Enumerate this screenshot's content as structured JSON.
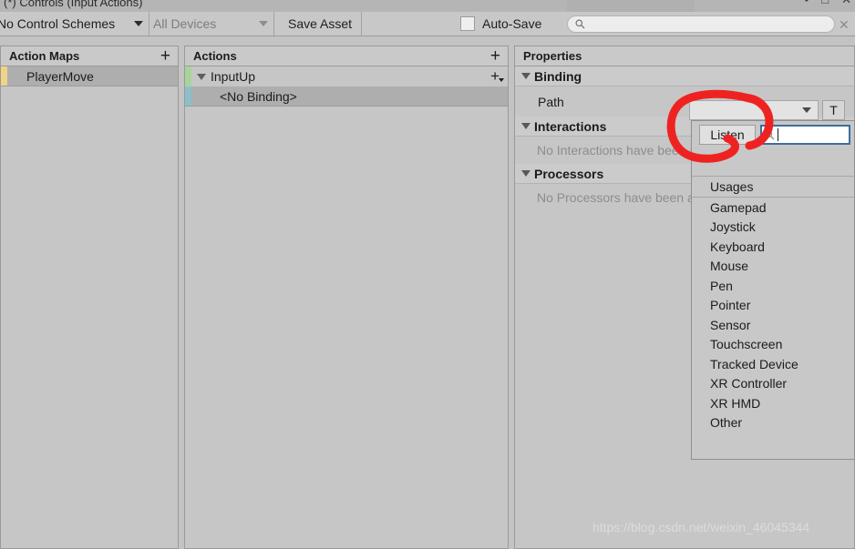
{
  "window": {
    "title": "(*) Controls (Input Actions)",
    "buttons": [
      {
        "name": "minimize-button",
        "glyph": "•"
      },
      {
        "name": "maximize-button",
        "glyph": "□"
      },
      {
        "name": "close-button",
        "glyph": "✕"
      }
    ]
  },
  "toolbar": {
    "control_schemes": "No Control Schemes",
    "devices": "All Devices",
    "save_asset": "Save Asset",
    "autosave_label": "Auto-Save",
    "autosave_checked": false,
    "search_value": "",
    "search_placeholder": "",
    "clear_glyph": "✕",
    "search_icon": "search-icon"
  },
  "action_maps": {
    "header": "Action Maps",
    "add_glyph": "+",
    "items": [
      {
        "label": "PlayerMove",
        "selected": true,
        "accent": "#f0d487"
      }
    ]
  },
  "actions": {
    "header": "Actions",
    "add_glyph": "+",
    "items": [
      {
        "label": "InputUp",
        "selected": false,
        "accent": "#a8d49a",
        "expanded": true,
        "add_glyph": "+"
      },
      {
        "label": "<No Binding>",
        "selected": true,
        "accent": "#8cc0c8",
        "expanded": false
      }
    ]
  },
  "properties": {
    "header": "Properties",
    "binding": {
      "title": "Binding",
      "path_label": "Path",
      "path_value": "",
      "t_button_label": "T"
    },
    "interactions": {
      "title": "Interactions",
      "empty_text": "No Interactions have been added."
    },
    "processors": {
      "title": "Processors",
      "empty_text": "No Processors have been added."
    }
  },
  "path_popup": {
    "listen_label": "Listen",
    "search_value": "",
    "search_icon": "search-icon",
    "usages_header": "Usages",
    "items": [
      "Gamepad",
      "Joystick",
      "Keyboard",
      "Mouse",
      "Pen",
      "Pointer",
      "Sensor",
      "Touchscreen",
      "Tracked Device",
      "XR Controller",
      "XR HMD",
      "Other"
    ]
  },
  "annotation": {
    "name": "red-circle-annotation",
    "color": "#ee2321",
    "targets": "listen-button"
  },
  "watermark": "https://blog.csdn.net/weixin_46045344"
}
